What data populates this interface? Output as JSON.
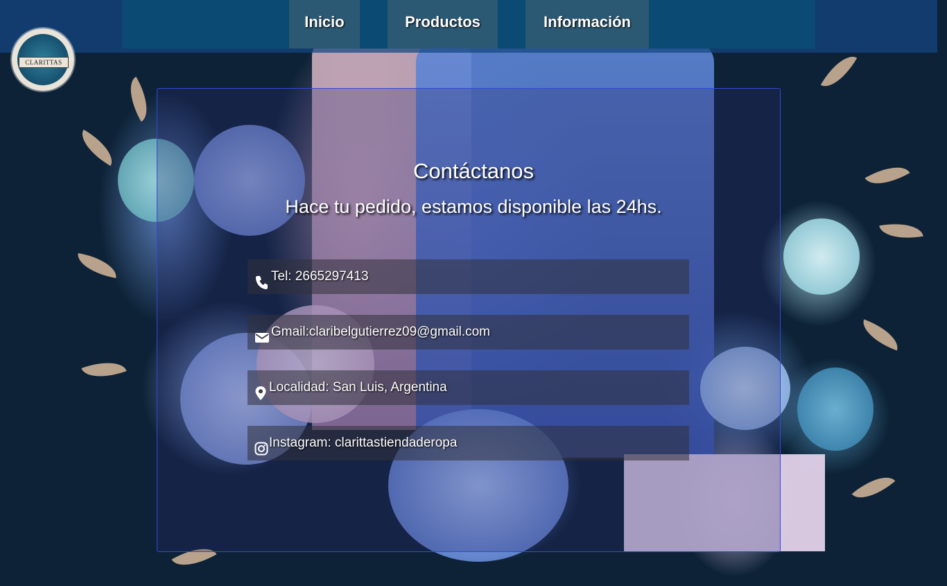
{
  "nav": {
    "items": [
      {
        "label": "Inicio"
      },
      {
        "label": "Productos"
      },
      {
        "label": "Información"
      }
    ]
  },
  "logo": {
    "text": "CLARITTAS"
  },
  "contact": {
    "title": "Contáctanos",
    "subtitle": "Hace tu pedido, estamos disponible las 24hs.",
    "items": [
      {
        "icon": "phone-icon",
        "text": "Tel: 2665297413"
      },
      {
        "icon": "envelope-icon",
        "text": "Gmail:claribelgutierrez09@gmail.com"
      },
      {
        "icon": "map-pin-icon",
        "text": "Localidad: San Luis, Argentina"
      },
      {
        "icon": "instagram-icon",
        "text": "Instagram: clarittastiendaderopa"
      }
    ]
  },
  "colors": {
    "nav_bg": "#0a4a73",
    "nav_item_bg": "#2b5872",
    "card_border": "#2f4bd8",
    "text": "#ffffff"
  }
}
